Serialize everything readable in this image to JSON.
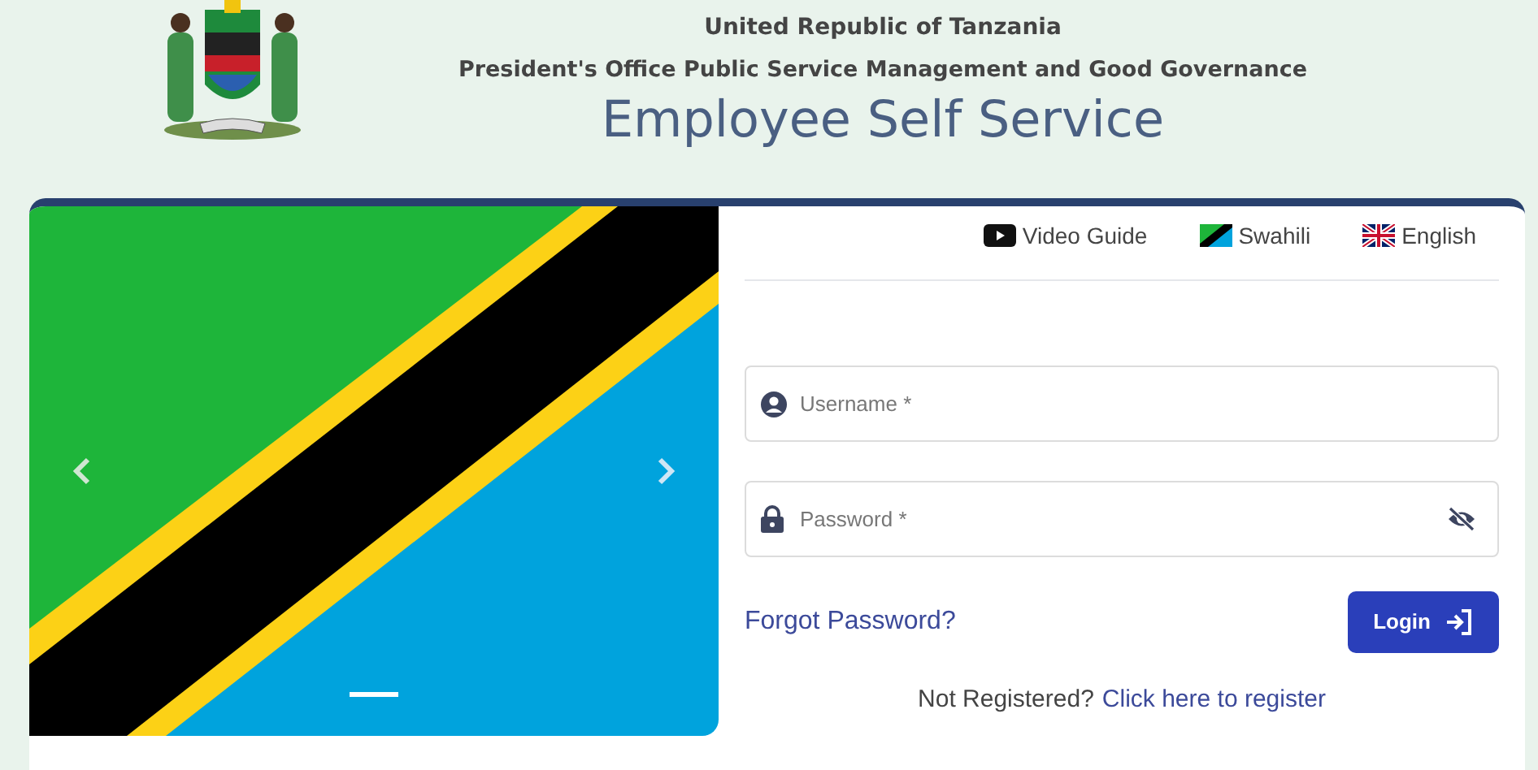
{
  "header": {
    "country": "United Republic of Tanzania",
    "office": "President's Office Public Service Management and Good Governance",
    "title": "Employee Self Service"
  },
  "carousel": {
    "indicators": [
      {
        "selected": true
      }
    ]
  },
  "top_links": [
    {
      "kind": "video",
      "label": "Video Guide"
    },
    {
      "kind": "tz",
      "label": "Swahili"
    },
    {
      "kind": "uk",
      "label": "English"
    }
  ],
  "form": {
    "username": {
      "placeholder": "Username *"
    },
    "password": {
      "placeholder": "Password *"
    },
    "forgot": "Forgot Password?",
    "login": "Login",
    "register_prompt": "Not Registered?",
    "register_link": "Click here to register"
  }
}
